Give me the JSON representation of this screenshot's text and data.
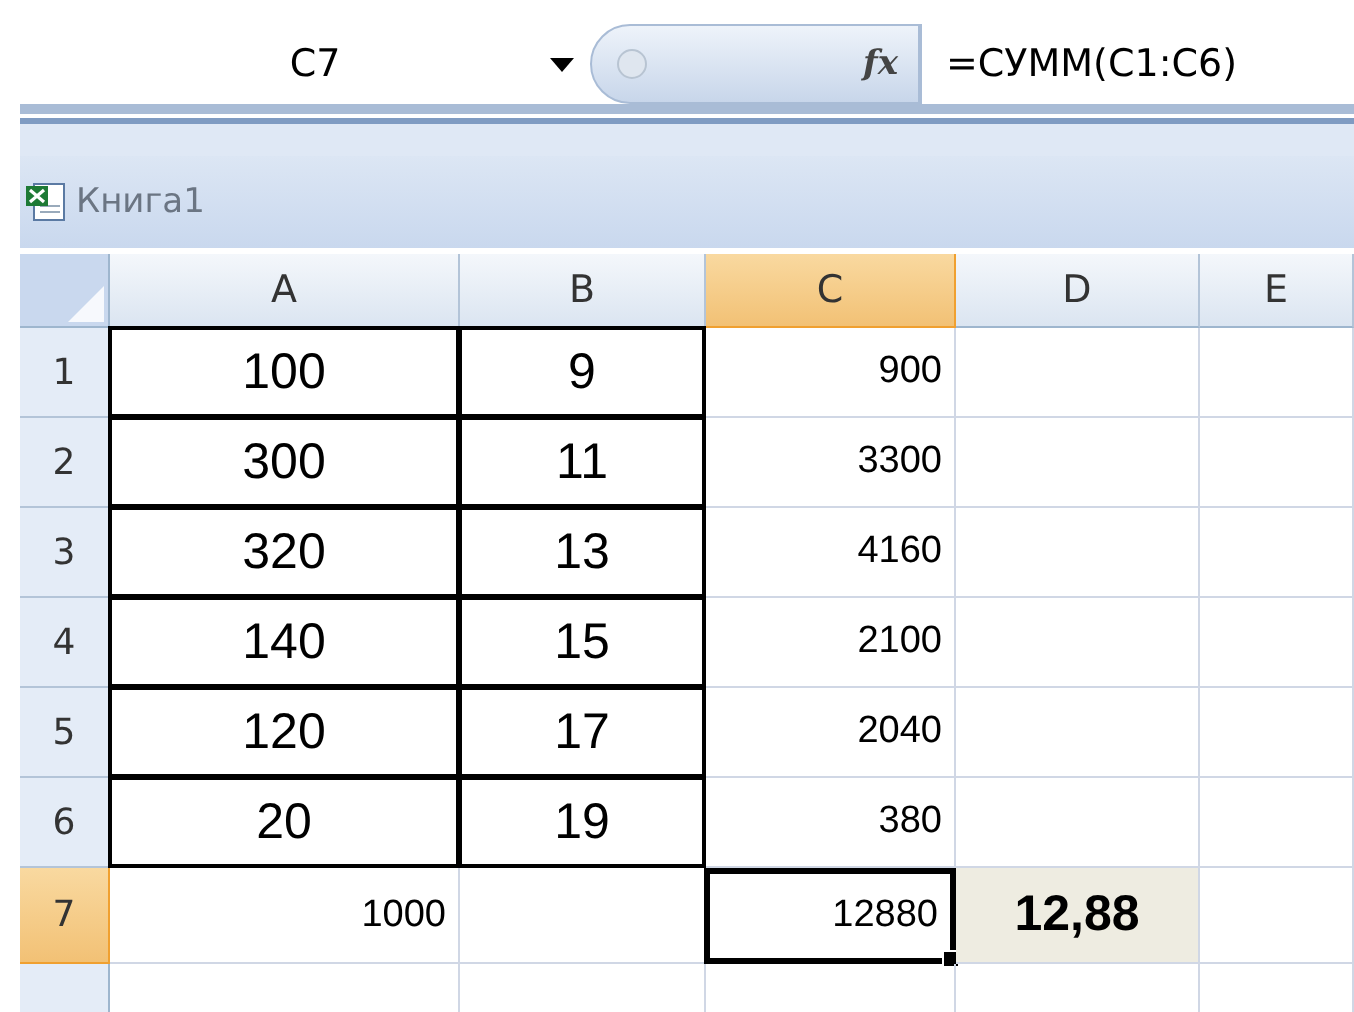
{
  "formula_bar": {
    "name_box": "C7",
    "function_label": "fx",
    "formula": "=СУММ(C1:C6)"
  },
  "workbook": {
    "title": "Книга1"
  },
  "columns": [
    {
      "label": "A",
      "selected": false
    },
    {
      "label": "B",
      "selected": false
    },
    {
      "label": "C",
      "selected": true
    },
    {
      "label": "D",
      "selected": false
    },
    {
      "label": "E",
      "selected": false
    }
  ],
  "rows": [
    {
      "label": "1",
      "selected": false,
      "cells": [
        {
          "kind": "boxed",
          "value": "100"
        },
        {
          "kind": "boxed",
          "value": "9"
        },
        {
          "kind": "number",
          "value": "900"
        }
      ]
    },
    {
      "label": "2",
      "selected": false,
      "cells": [
        {
          "kind": "boxed",
          "value": "300"
        },
        {
          "kind": "boxed",
          "value": "11"
        },
        {
          "kind": "number",
          "value": "3300"
        }
      ]
    },
    {
      "label": "3",
      "selected": false,
      "cells": [
        {
          "kind": "boxed",
          "value": "320"
        },
        {
          "kind": "boxed",
          "value": "13"
        },
        {
          "kind": "number",
          "value": "4160"
        }
      ]
    },
    {
      "label": "4",
      "selected": false,
      "cells": [
        {
          "kind": "boxed",
          "value": "140"
        },
        {
          "kind": "boxed",
          "value": "15"
        },
        {
          "kind": "number",
          "value": "2100"
        }
      ]
    },
    {
      "label": "5",
      "selected": false,
      "cells": [
        {
          "kind": "boxed",
          "value": "120"
        },
        {
          "kind": "boxed",
          "value": "17"
        },
        {
          "kind": "number",
          "value": "2040"
        }
      ]
    },
    {
      "label": "6",
      "selected": false,
      "cells": [
        {
          "kind": "boxed",
          "value": "20"
        },
        {
          "kind": "boxed",
          "value": "19"
        },
        {
          "kind": "number",
          "value": "380"
        }
      ]
    },
    {
      "label": "7",
      "selected": true,
      "cells": [
        {
          "kind": "number",
          "value": "1000"
        },
        {
          "kind": "plain"
        },
        {
          "kind": "active",
          "value": "12880"
        },
        {
          "kind": "result",
          "value": "12,88"
        }
      ]
    },
    {
      "label": "",
      "selected": false,
      "cells": []
    }
  ]
}
